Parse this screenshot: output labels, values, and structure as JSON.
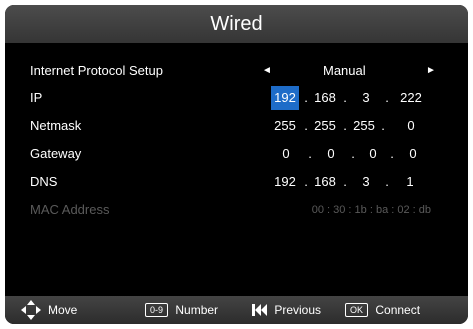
{
  "title": "Wired",
  "rows": [
    {
      "label": "Internet Protocol Setup",
      "value": "Manual",
      "left_arrow": "◄",
      "right_arrow": "►"
    },
    {
      "label": "IP",
      "octets": [
        "192",
        "168",
        "3",
        "222"
      ]
    },
    {
      "label": "Netmask",
      "octets": [
        "255",
        "255",
        "255",
        "0"
      ]
    },
    {
      "label": "Gateway",
      "octets": [
        "0",
        "0",
        "0",
        "0"
      ]
    },
    {
      "label": "DNS",
      "octets": [
        "192",
        "168",
        "3",
        "1"
      ]
    },
    {
      "label": "MAC Address",
      "value": "00 : 30 : 1b : ba : 02 : db"
    }
  ],
  "separator": ".",
  "footer": {
    "move": "Move",
    "number_key": "0-9",
    "number": "Number",
    "previous": "Previous",
    "ok_key": "OK",
    "connect": "Connect"
  },
  "colors": {
    "selection": "#1e6cc8",
    "disabled_text": "#5a5a5a",
    "title_bar": "#404040"
  }
}
